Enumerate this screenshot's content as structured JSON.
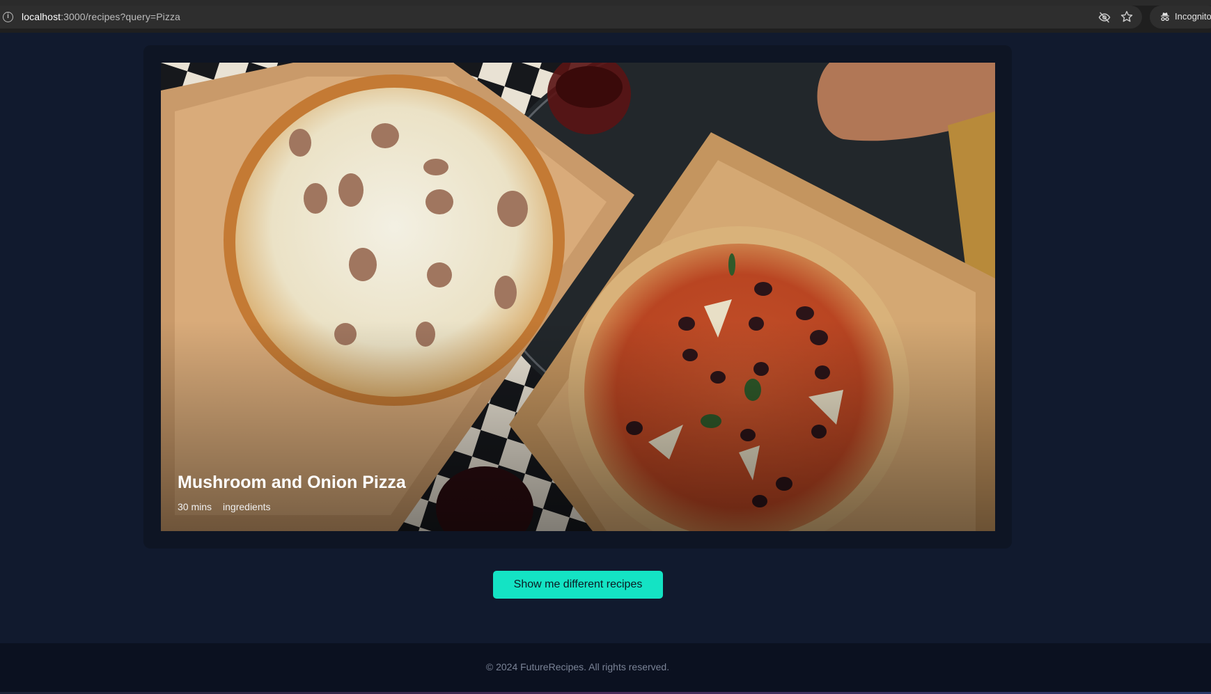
{
  "browser": {
    "url_host": "localhost",
    "url_rest": ":3000/recipes?query=Pizza",
    "incognito_label": "Incognito",
    "icons": [
      "info-icon",
      "eye-off-icon",
      "star-icon",
      "incognito-icon"
    ]
  },
  "recipe": {
    "title": "Mushroom and Onion Pizza",
    "time": "30 mins",
    "ingredients_label": "ingredients"
  },
  "actions": {
    "different_recipes_label": "Show me different recipes"
  },
  "footer": {
    "copyright": "© 2024 FutureRecipes. All rights reserved."
  },
  "colors": {
    "page_background": "#111a2e",
    "card_background": "#0e1524",
    "accent": "#14e3c4",
    "footer_background": "#0b1120"
  }
}
